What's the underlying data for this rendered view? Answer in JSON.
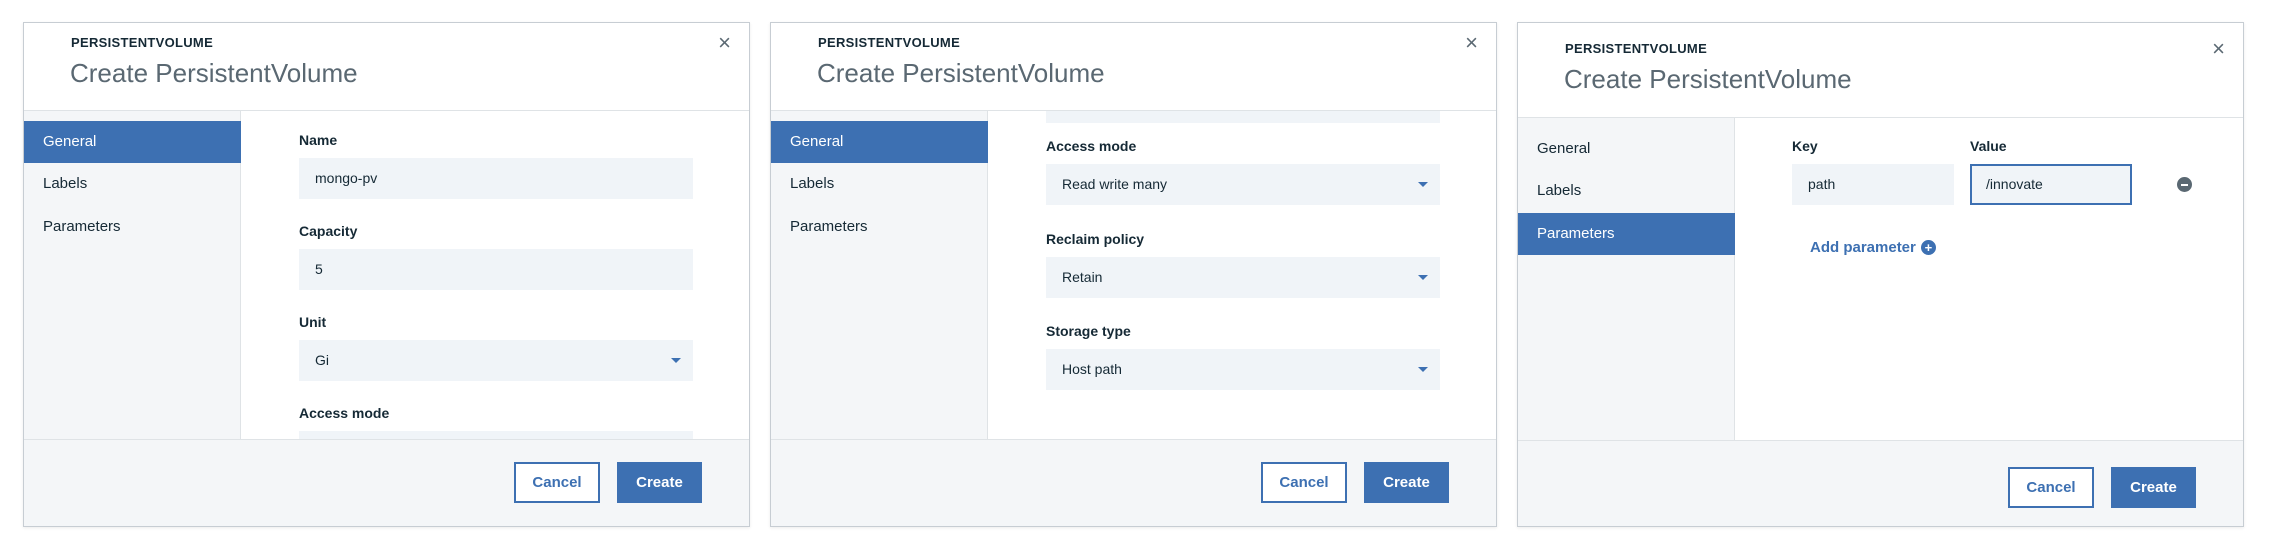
{
  "dialogs": [
    {
      "eyebrow": "PERSISTENTVOLUME",
      "title": "Create PersistentVolume",
      "close": "×",
      "nav": [
        "General",
        "Labels",
        "Parameters"
      ],
      "active_nav": "General",
      "fields": {
        "name_label": "Name",
        "name_value": "mongo-pv",
        "capacity_label": "Capacity",
        "capacity_value": "5",
        "unit_label": "Unit",
        "unit_value": "Gi",
        "access_mode_label": "Access mode"
      },
      "cancel": "Cancel",
      "create": "Create"
    },
    {
      "eyebrow": "PERSISTENTVOLUME",
      "title": "Create PersistentVolume",
      "close": "×",
      "nav": [
        "General",
        "Labels",
        "Parameters"
      ],
      "active_nav": "General",
      "fields": {
        "access_mode_label": "Access mode",
        "access_mode_value": "Read write many",
        "reclaim_policy_label": "Reclaim policy",
        "reclaim_policy_value": "Retain",
        "storage_type_label": "Storage type",
        "storage_type_value": "Host path"
      },
      "cancel": "Cancel",
      "create": "Create"
    },
    {
      "eyebrow": "PERSISTENTVOLUME",
      "title": "Create PersistentVolume",
      "close": "×",
      "nav": [
        "General",
        "Labels",
        "Parameters"
      ],
      "active_nav": "Parameters",
      "params": {
        "key_label": "Key",
        "value_label": "Value",
        "key_value": "path",
        "value_value": "/innovate",
        "add_parameter": "Add parameter",
        "add_icon_glyph": "+"
      },
      "cancel": "Cancel",
      "create": "Create"
    }
  ],
  "colors": {
    "accent": "#3d70b2",
    "sidebar_bg": "#f4f6f8",
    "field_bg": "#f0f4f8",
    "text": "#152935",
    "muted": "#5a6872"
  }
}
